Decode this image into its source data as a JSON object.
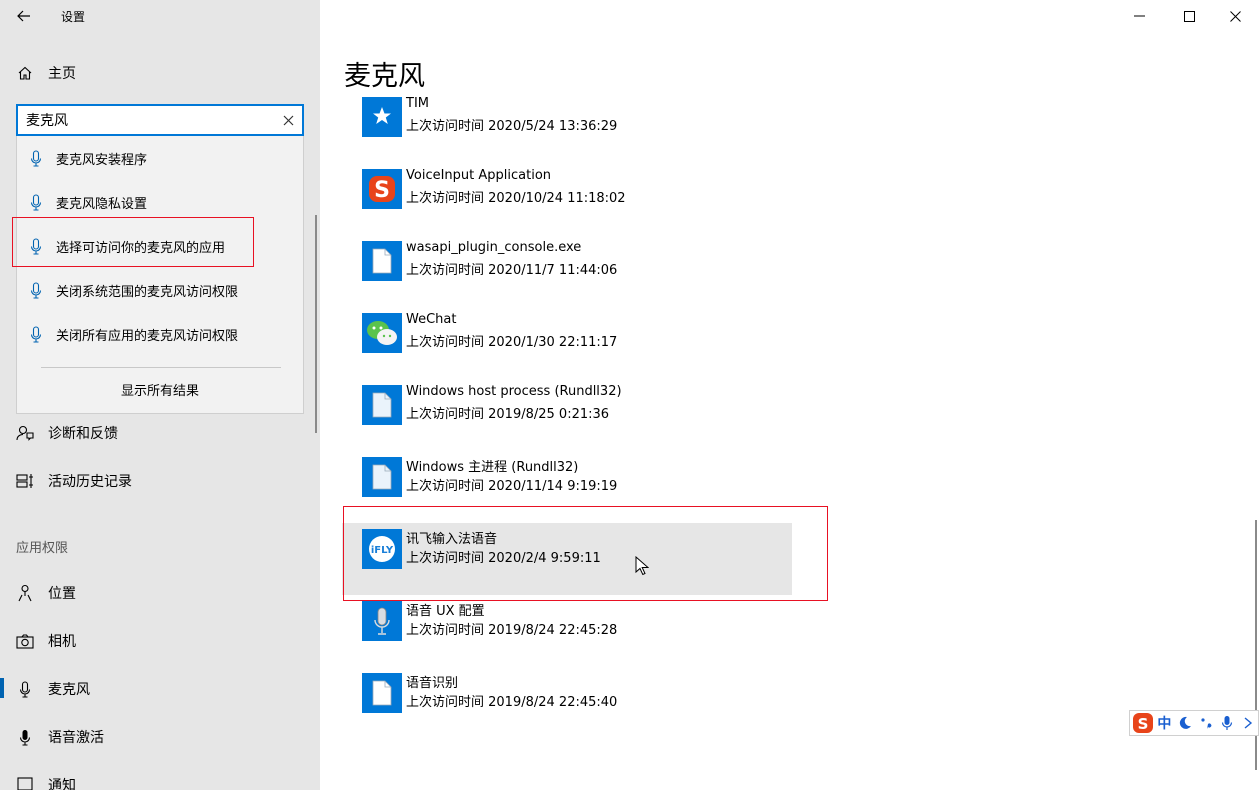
{
  "window": {
    "title": "设置",
    "minimize_glyph": "–",
    "maximize_glyph": "☐",
    "close_glyph": "✕"
  },
  "sidebar": {
    "home_label": "主页",
    "search": {
      "value": "麦克风",
      "placeholder": ""
    },
    "suggestions": [
      {
        "label": "麦克风安装程序",
        "icon": "microphone-icon"
      },
      {
        "label": "麦克风隐私设置",
        "icon": "microphone-icon"
      },
      {
        "label": "选择可访问你的麦克风的应用",
        "icon": "microphone-icon"
      },
      {
        "label": "关闭系统范围的麦克风访问权限",
        "icon": "microphone-icon"
      },
      {
        "label": "关闭所有应用的麦克风访问权限",
        "icon": "microphone-icon"
      }
    ],
    "show_all_label": "显示所有结果",
    "items": [
      {
        "label": "诊断和反馈",
        "icon": "feedback-person-icon"
      },
      {
        "label": "活动历史记录",
        "icon": "timeline-icon"
      }
    ],
    "section_header": "应用权限",
    "permission_items": [
      {
        "label": "位置",
        "icon": "location-icon"
      },
      {
        "label": "相机",
        "icon": "camera-icon"
      },
      {
        "label": "麦克风",
        "icon": "microphone-icon",
        "selected": true
      },
      {
        "label": "语音激活",
        "icon": "voice-activation-icon"
      },
      {
        "label": "通知",
        "icon": "notification-icon"
      }
    ]
  },
  "main": {
    "title": "麦克风",
    "apps": [
      {
        "name": "TIM",
        "last_access": "上次访问时间 2020/5/24 13:36:29",
        "icon": "tim-icon"
      },
      {
        "name": "VoiceInput Application",
        "last_access": "上次访问时间 2020/10/24 11:18:02",
        "icon": "sogou-icon"
      },
      {
        "name": "wasapi_plugin_console.exe",
        "last_access": "上次访问时间 2020/11/7 11:44:06",
        "icon": "file-icon"
      },
      {
        "name": "WeChat",
        "last_access": "上次访问时间 2020/1/30 22:11:17",
        "icon": "wechat-icon"
      },
      {
        "name": "Windows host process (Rundll32)",
        "last_access": "上次访问时间 2019/8/25 0:21:36",
        "icon": "file-icon"
      },
      {
        "name": "Windows 主进程 (Rundll32)",
        "last_access": "上次访问时间 2020/11/14 9:19:19",
        "icon": "file-icon"
      },
      {
        "name": "讯飞输入法语音",
        "last_access": "上次访问时间 2020/2/4 9:59:11",
        "icon": "ifly-icon",
        "highlighted": true
      },
      {
        "name": "语音 UX 配置",
        "last_access": "上次访问时间 2019/8/24 22:45:28",
        "icon": "microphone-app-icon"
      },
      {
        "name": "语音识别",
        "last_access": "上次访问时间 2019/8/24 22:45:40",
        "icon": "file-icon"
      }
    ]
  },
  "ime_toolbar": {
    "mode_label": "中",
    "icons": [
      "sogou-logo-icon",
      "moon-icon",
      "punctuation-icon",
      "microphone-icon"
    ]
  },
  "colors": {
    "accent": "#0078d7",
    "sidebar_bg": "#e6e6e6",
    "highlight_box": "#e81123"
  }
}
